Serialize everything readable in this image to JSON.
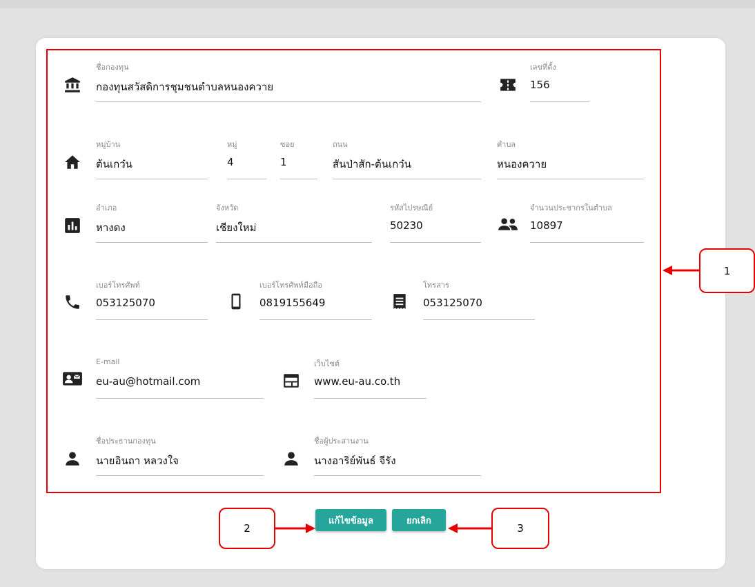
{
  "form": {
    "fund_name": {
      "label": "ชื่อกองทุน",
      "value": "กองทุนสวัสดิการชุมชนตำบลหนองควาย"
    },
    "address_no": {
      "label": "เลขที่ตั้ง",
      "value": "156"
    },
    "village": {
      "label": "หมู่บ้าน",
      "value": "ต้นเกว๋น"
    },
    "moo": {
      "label": "หมู่",
      "value": "4"
    },
    "soi": {
      "label": "ซอย",
      "value": "1"
    },
    "road": {
      "label": "ถนน",
      "value": "สันป่าสัก-ต้นเกว๋น"
    },
    "subdistrict": {
      "label": "ตำบล",
      "value": "หนองควาย"
    },
    "district": {
      "label": "อำเภอ",
      "value": "หางดง"
    },
    "province": {
      "label": "จังหวัด",
      "value": "เชียงใหม่"
    },
    "postcode": {
      "label": "รหัสไปรษณีย์",
      "value": "50230"
    },
    "population": {
      "label": "จำนวนประชากรในตำบล",
      "value": "10897"
    },
    "phone": {
      "label": "เบอร์โทรศัพท์",
      "value": "053125070"
    },
    "mobile": {
      "label": "เบอร์โทรศัพท์มือถือ",
      "value": "0819155649"
    },
    "fax": {
      "label": "โทรสาร",
      "value": "053125070"
    },
    "email": {
      "label": "E-mail",
      "value": "eu-au@hotmail.com"
    },
    "website": {
      "label": "เว็บไซต์",
      "value": "www.eu-au.co.th"
    },
    "chairman": {
      "label": "ชื่อประธานกองทุน",
      "value": "นายอินถา หลวงใจ"
    },
    "coordinator": {
      "label": "ชื่อผู้ประสานงาน",
      "value": "นางอาริย์พันธ์ จีรัง"
    }
  },
  "buttons": {
    "edit": "แก้ไขข้อมูล",
    "cancel": "ยกเลิก"
  },
  "callouts": {
    "one": "1",
    "two": "2",
    "three": "3"
  },
  "icons": {
    "fund": "bank-icon",
    "address": "ticket-icon",
    "village": "home-icon",
    "district": "chart-icon",
    "population": "people-icon",
    "phone": "phone-icon",
    "mobile": "mobile-icon",
    "fax": "fax-icon",
    "email": "contact-card-icon",
    "website": "web-icon",
    "chairman": "person-icon",
    "coordinator": "person-icon"
  },
  "colors": {
    "accent": "#26a69a",
    "annotation": "#e60000"
  }
}
